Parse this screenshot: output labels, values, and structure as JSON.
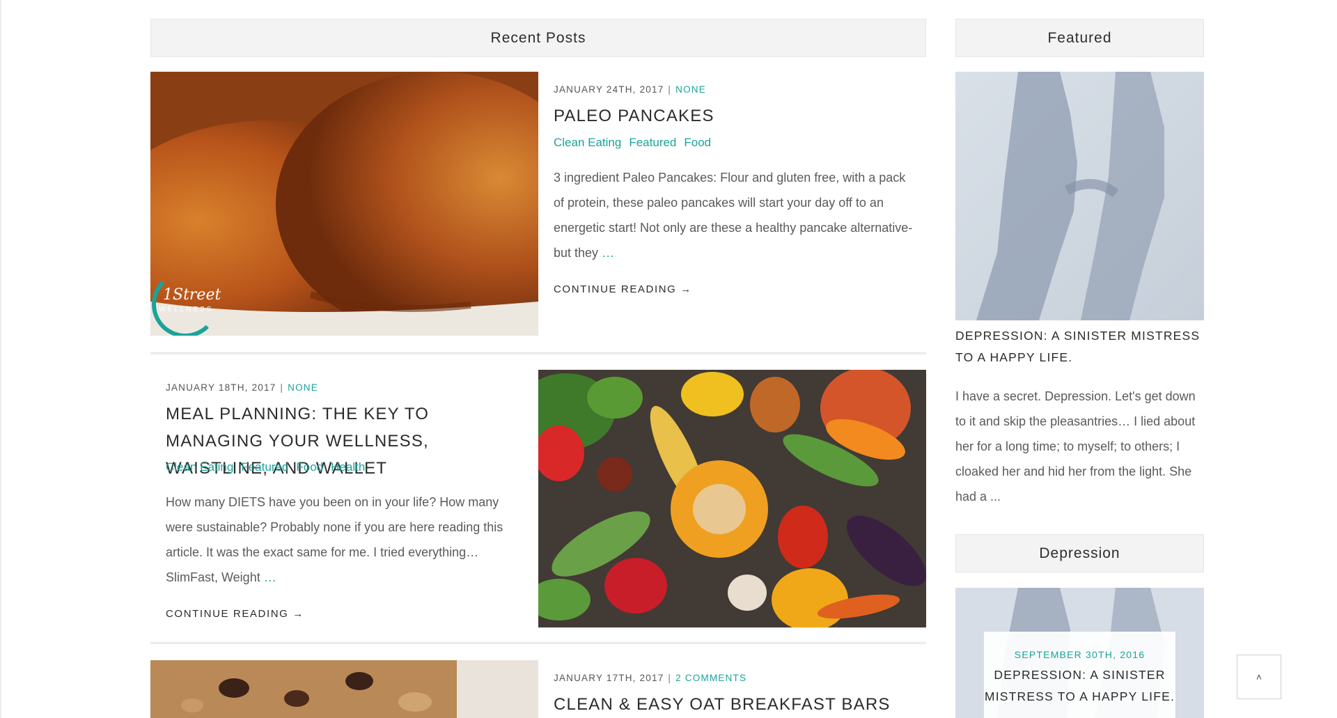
{
  "recent_posts": {
    "heading": "Recent Posts",
    "posts": [
      {
        "date": "JANUARY 24TH, 2017",
        "meta_link": "NONE",
        "title": "PALEO PANCAKES",
        "categories": [
          "Clean Eating",
          "Featured",
          "Food"
        ],
        "excerpt": "3 ingredient Paleo Pancakes: Flour and gluten free, with a pack of protein, these paleo pancakes will start your day off to an energetic start!  Not only are these a healthy pancake alternative- but they",
        "more": "…",
        "continue": "CONTINUE READING →",
        "image_logo_text": [
          "1Street",
          "WELLNESS"
        ]
      },
      {
        "date": "JANUARY 18TH, 2017",
        "meta_link": "NONE",
        "title": "MEAL PLANNING: THE KEY TO MANAGING YOUR WELLNESS, WAISTLINE, AND WALLET",
        "categories": [
          "Clean Eating",
          "Featured",
          "Food",
          "Health"
        ],
        "excerpt": "How many DIETS have you been on in your life?  How many were sustainable? Probably none if you are here reading this article.  It was the exact same for me.  I tried everything… SlimFast, Weight",
        "more": "…",
        "continue": "CONTINUE READING →"
      },
      {
        "date": "JANUARY 17TH, 2017",
        "meta_link": "2 COMMENTS",
        "title": "CLEAN & EASY OAT BREAKFAST BARS"
      }
    ]
  },
  "featured": {
    "heading": "Featured",
    "title": "DEPRESSION: A SINISTER MISTRESS TO A HAPPY LIFE.",
    "excerpt": "I have a secret. Depression.  Let's get down to it and skip the pleasantries… I lied about her for a long time; to myself; to others;  I cloaked her and hid her from the light. She had a ..."
  },
  "depression": {
    "heading": "Depression",
    "card_date": "SEPTEMBER 30TH, 2016",
    "card_title": "DEPRESSION: A SINISTER MISTRESS TO A HAPPY LIFE."
  },
  "scroll_top": {
    "icon": "chevron-up-icon",
    "glyph": "˄"
  },
  "colors": {
    "accent": "#1aa39a",
    "heading_bg": "#f3f3f3",
    "text": "#5a5a5a"
  }
}
